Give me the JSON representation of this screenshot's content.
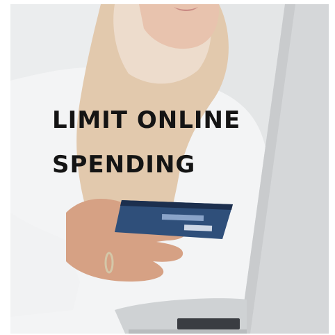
{
  "image": {
    "headline": {
      "line1": "LIMIT ONLINE",
      "line2": "SPENDING"
    },
    "colors": {
      "text": "#141414",
      "hijab": "#e2c9ad",
      "card": "#2f4f7a",
      "skin": "#d6a184",
      "laptop": "#d8dadc"
    },
    "subjects": [
      "woman-in-hijab",
      "credit-card",
      "laptop",
      "hand-with-ring"
    ]
  }
}
